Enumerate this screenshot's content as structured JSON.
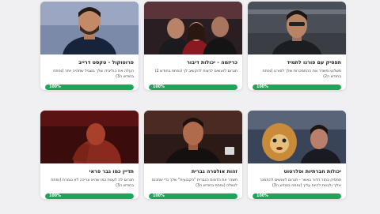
{
  "colors": {
    "progress": "#1ea55a",
    "background": "#f0f0f2"
  },
  "courses": [
    {
      "title": "פרוטוקול - טקסט דרייב",
      "description": "העלה את הוליבידו שלך בשביל שתהיה יותר (נפתח בחודש ה3)",
      "progress_label": "100%",
      "progress": 1.0
    },
    {
      "title": "כריזמה - יכולות דיבור",
      "description": "תגרום לאנשים לרצות להקשיב לך (נפתח בחודש 2)",
      "progress_label": "100%",
      "progress": 1.0
    },
    {
      "title": "תפסיק עם פורנו לתמיד",
      "description": "תשלוט ותשדר את ההתמכרות שלך לפורנו (נפתח בחודש ה2)",
      "progress_label": "100%",
      "progress": 1.0
    },
    {
      "title": "תדיין כמו גבר פראי",
      "description": "תגרום לה לענות כמו שהיא צריכה לא נגמרת (נפתח בחודש ה3)",
      "progress_label": "100%",
      "progress": 1.0
    },
    {
      "title": "זהות אולטרה גברית",
      "description": "תשדר את הדמות הגברית \"הקבועית\" שלך כדי שתכנס לנשלה (נפתח בחודש ה3)",
      "progress_label": "100%",
      "progress": 1.0
    },
    {
      "title": "יכולות חברתיות ופלרטוט",
      "description": "תפסיק בתור הדור כאשר - תגרום לאנשים להתמכר אליך ולבנות להיות עליך (נפתח בחודש ה3)",
      "progress_label": "100%",
      "progress": 1.0
    }
  ]
}
